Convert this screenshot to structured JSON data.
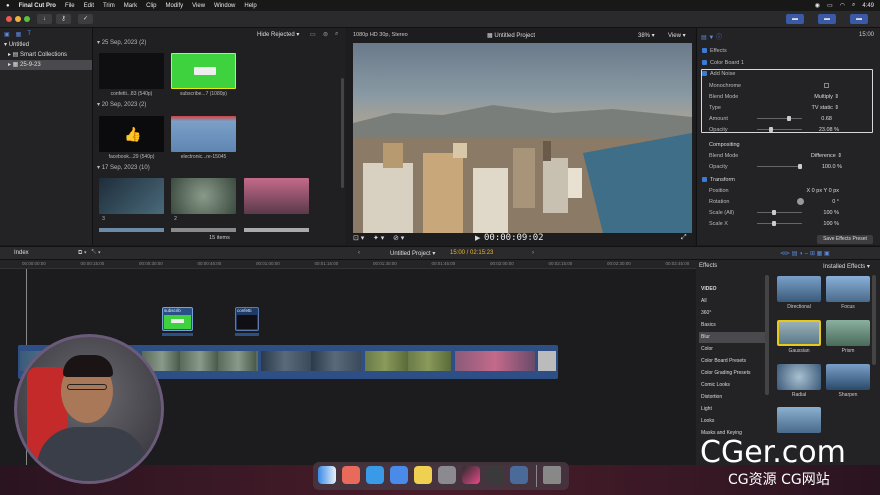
{
  "menubar": {
    "apple": "",
    "items": [
      "Final Cut Pro",
      "File",
      "Edit",
      "Trim",
      "Mark",
      "Clip",
      "Modify",
      "View",
      "Window",
      "Help"
    ],
    "clock": "4:49"
  },
  "sidebar": {
    "items": [
      {
        "label": "Untitled",
        "indent": 0
      },
      {
        "label": "Smart Collections",
        "indent": 1
      },
      {
        "label": "25-9-23",
        "indent": 1
      }
    ]
  },
  "browser": {
    "filter": "Hide Rejected",
    "groups": [
      {
        "date": "25 Sep, 2023",
        "count": "(2)"
      },
      {
        "date": "20 Sep, 2023",
        "count": "(2)"
      },
      {
        "date": "17 Sep, 2023",
        "count": "(10)"
      }
    ],
    "clips": [
      {
        "label": "confetti...83 (540p)",
        "color": "#0f0f12"
      },
      {
        "label": "subscribe...7 (1080p)",
        "color": "#3ed33e"
      },
      {
        "label": "facebook...29 (540p)",
        "color": "#0b0b0e"
      },
      {
        "label": "electronic...re-15045",
        "color": "#5f86b2"
      },
      {
        "label": "3",
        "color": "#2e4a5a"
      },
      {
        "label": "2",
        "color": "#4a5a4e"
      },
      {
        "label": "",
        "color": "#8a4a5a"
      }
    ],
    "items_count": "15 items"
  },
  "viewer": {
    "format": "1080p HD 30p, Stereo",
    "project": "Untitled Project",
    "zoom": "38%",
    "view": "View",
    "timecode": "00:00:09:02"
  },
  "inspector": {
    "timecode": "15:00",
    "sections": [
      {
        "label": "Effects",
        "checked": true
      },
      {
        "label": "Color Board 1",
        "checked": true
      },
      {
        "label": "Add Noise",
        "checked": true
      }
    ],
    "params": [
      {
        "label": "Monochrome",
        "value": ""
      },
      {
        "label": "Blend Mode",
        "value": "Multiply"
      },
      {
        "label": "Type",
        "value": "TV static"
      },
      {
        "label": "Amount",
        "value": "0.68"
      },
      {
        "label": "Opacity",
        "value": "23.08 %"
      },
      {
        "label": "Compositing",
        "value": ""
      },
      {
        "label": "Blend Mode",
        "value": "Difference"
      },
      {
        "label": "Opacity",
        "value": "100.0 %"
      },
      {
        "label": "Transform",
        "value": ""
      },
      {
        "label": "Position",
        "value": "X   0 px   Y   0 px"
      },
      {
        "label": "Rotation",
        "value": "0 °"
      },
      {
        "label": "Scale (All)",
        "value": "100 %"
      },
      {
        "label": "Scale X",
        "value": "100 %"
      }
    ],
    "save_preset": "Save Effects Preset"
  },
  "timeline": {
    "index": "Index",
    "project": "Untitled Project",
    "duration": "15:00 / 02:15:23",
    "ruler": [
      "00:00:00:00",
      "00:00:15:00",
      "00:00:30:00",
      "00:00:45:00",
      "00:01:00:00",
      "00:01:15:00",
      "00:01:30:00",
      "00:01:45:00",
      "00:02:00:00",
      "00:02:15:00",
      "00:02:30:00",
      "00:02:45:00"
    ],
    "clip_labels": [
      "subscrib",
      "confetti"
    ]
  },
  "effects": {
    "title": "Effects",
    "installed": "Installed Effects",
    "categories": [
      "VIDEO",
      "All",
      "360°",
      "Basics",
      "Blur",
      "Color",
      "Color Board Presets",
      "Color Grading Presets",
      "Comic Looks",
      "Distortion",
      "Light",
      "Looks",
      "Masks and Keying"
    ],
    "selected": "Blur",
    "items": [
      "Directional",
      "Focus",
      "Gaussian",
      "Prism",
      "Radial",
      "Sharpen",
      ""
    ]
  },
  "watermark": {
    "line1": "CGer.com",
    "line2": "CG资源 CG网站"
  },
  "colors": {
    "accent": "#3a7bd5",
    "green": "#3ed33e",
    "clip_blue": "#2d4f86"
  }
}
